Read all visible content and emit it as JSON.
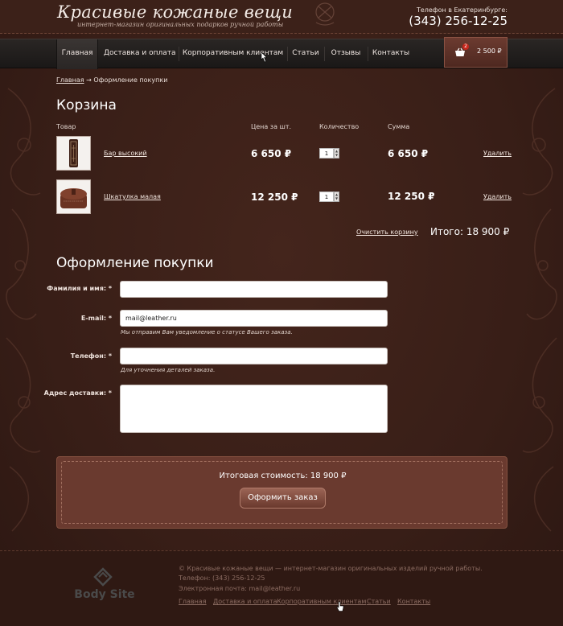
{
  "header": {
    "title": "Красивые кожаные вещи",
    "subtitle": "интернет-магазин оригинальных подарков ручной работы",
    "phone_label": "Телефон в Екатеринбурге:",
    "phone": "(343) 256-12-25"
  },
  "nav": {
    "items": [
      {
        "label": "Главная",
        "active": true
      },
      {
        "label": "Доставка и оплата",
        "active": false
      },
      {
        "label": "Корпоративным клиентам",
        "active": false
      },
      {
        "label": "Статьи",
        "active": false
      },
      {
        "label": "Отзывы",
        "active": false
      },
      {
        "label": "Контакты",
        "active": false
      }
    ]
  },
  "cart": {
    "badge": "2",
    "total": "2 500 ₽"
  },
  "breadcrumb": {
    "home": "Главная",
    "separator": "→",
    "current": "Оформление покупки"
  },
  "basket": {
    "title": "Корзина",
    "columns": [
      "Товар",
      "Цена за шт.",
      "Количество",
      "Сумма"
    ],
    "rows": [
      {
        "name": "Бар высокий",
        "price": "6 650 ₽",
        "qty": "1",
        "sum": "6 650 ₽",
        "delete": "Удалить"
      },
      {
        "name": "Шкатулка малая",
        "price": "12 250 ₽",
        "qty": "1",
        "sum": "12 250 ₽",
        "delete": "Удалить"
      }
    ],
    "clear_label": "Очистить корзину",
    "total_label": "Итого: 18 900 ₽"
  },
  "checkout": {
    "title": "Оформление покупки",
    "fields": {
      "name": {
        "label": "Фамилия и имя: *",
        "value": ""
      },
      "email": {
        "label": "E-mail: *",
        "value": "mail@leather.ru",
        "hint": "Мы отправим Вам уведомление о статусе Вашего заказа."
      },
      "phone": {
        "label": "Телефон: *",
        "value": "",
        "hint": "Для уточнения деталей заказа."
      },
      "address": {
        "label": "Адрес доставки: *",
        "value": ""
      }
    }
  },
  "summary": {
    "total_text": "Итоговая стоимость: 18 900 ₽",
    "button": "Оформить заказ"
  },
  "footer": {
    "logo_text": "Body Site",
    "line1": "© Красивые кожаные вещи — интернет-магазин оригинальных изделий ручной работы.",
    "line2": "Телефон: (343) 256-12-25",
    "line3": "Электронная почта: mail@leather.ru",
    "links": [
      "Главная",
      "Доставка и оплата",
      "Корпоративным клиентам",
      "Статьи",
      "Контакты"
    ]
  },
  "colors": {
    "background": "#3a2019",
    "nav": "#1f1c1b",
    "cart_box": "#5c3027",
    "summary_box": "#6a3a2f"
  }
}
